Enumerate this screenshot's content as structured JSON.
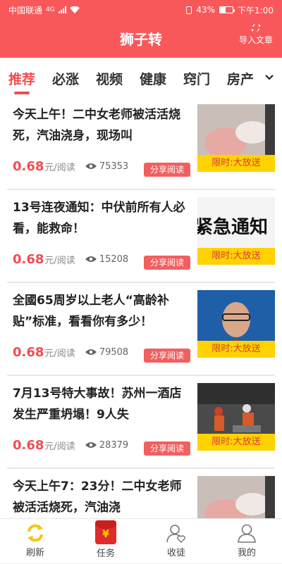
{
  "status_bar": {
    "carrier": "中国联通",
    "network": "4G",
    "battery": "43%",
    "battery_level": 0.43,
    "time": "下午1:00"
  },
  "header": {
    "title": "狮子转",
    "import_label": "导入文章"
  },
  "tabs": [
    {
      "label": "推荐",
      "active": true
    },
    {
      "label": "必涨"
    },
    {
      "label": "视频"
    },
    {
      "label": "健康"
    },
    {
      "label": "窍门"
    },
    {
      "label": "房产"
    }
  ],
  "articles": [
    {
      "title": "今天上午！二中女老师被活活烧死，汽油浇身，现场叫",
      "price": "0.68",
      "unit": "元/阅读",
      "views": "75353",
      "share_label": "分享阅读",
      "promo": "限时:大放送",
      "thumb": "blurred-scene"
    },
    {
      "title": "13号连夜通知：中伏前所有人必看，能救命！",
      "price": "0.68",
      "unit": "元/阅读",
      "views": "15208",
      "share_label": "分享阅读",
      "promo": "限时:大放送",
      "thumb_text": "紧急通知"
    },
    {
      "title": "全國65周岁以上老人“高龄补贴”标准，看看你有多少！",
      "price": "0.68",
      "unit": "元/阅读",
      "views": "79508",
      "share_label": "分享阅读",
      "promo": "限时:大放送",
      "thumb": "portrait"
    },
    {
      "title": "7月13号特大事故！苏州一酒店发生严重坍塌！9人失",
      "price": "0.68",
      "unit": "元/阅读",
      "views": "28379",
      "share_label": "分享阅读",
      "promo": "限时:大放送",
      "thumb": "rescue-scene"
    },
    {
      "title": "今天上午7：23分！二中女老师被活活烧死，汽油浇",
      "price": "",
      "unit": "",
      "views": "",
      "share_label": "",
      "promo": "",
      "thumb": "blurred-scene"
    }
  ],
  "bottom_nav": [
    {
      "label": "刷新",
      "icon": "refresh-icon"
    },
    {
      "label": "任务",
      "icon": "red-envelope-icon"
    },
    {
      "label": "收徒",
      "icon": "add-friend-icon"
    },
    {
      "label": "我的",
      "icon": "user-icon"
    }
  ],
  "colors": {
    "brand": "#f9585a",
    "accent": "#f24d4f",
    "promo_bg": "#ffd200"
  }
}
